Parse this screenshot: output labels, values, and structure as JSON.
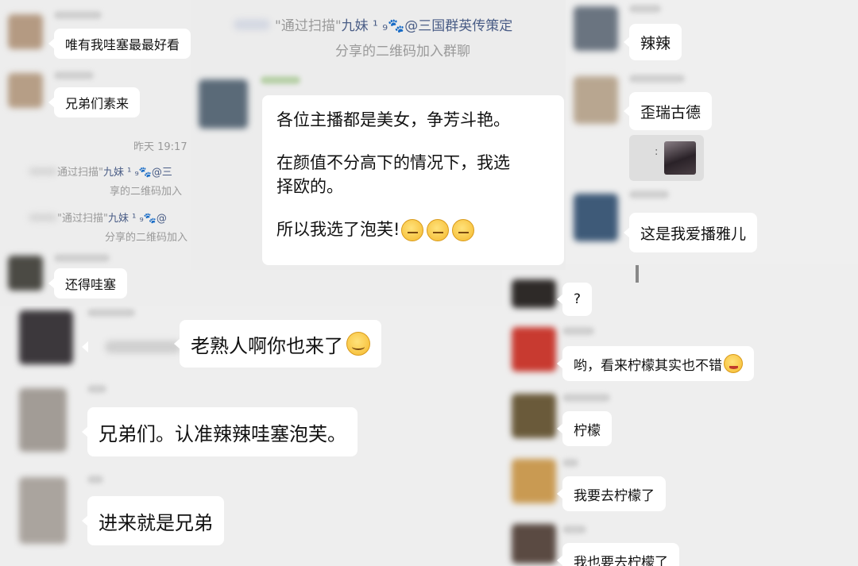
{
  "left_top": {
    "messages": [
      {
        "text": "唯有我哇塞最最好看"
      },
      {
        "text": "兄弟们素来"
      }
    ],
    "timestamp": "昨天 19:17",
    "system_notices": [
      {
        "prefix": "通过扫描\"",
        "name": "九妹 ¹ ₉🐾@三",
        "suffix": ""
      },
      {
        "line2": "享的二维码加入"
      },
      {
        "prefix": "\"通过扫描\"",
        "name": "九妹 ¹ ₉🐾@",
        "suffix": ""
      },
      {
        "line2": "分享的二维码加入"
      }
    ],
    "last_message": "还得哇塞"
  },
  "top_center": {
    "notice_prefix": "\"通过扫描\"",
    "notice_name": "九妹 ¹ ₉🐾@三国群英传策定",
    "notice_line2": "分享的二维码加入群聊",
    "big_message": {
      "line1": "各位主播都是美女，争芳斗艳。",
      "line2": "在颜值不分高下的情况下，我选",
      "line3": "择欧的。",
      "line4": "所以我选了泡芙!"
    }
  },
  "left_bottom": {
    "messages": [
      {
        "text": "老熟人啊你也来了"
      },
      {
        "text": "兄弟们。认准辣辣哇塞泡芙。"
      },
      {
        "text": "进来就是兄弟"
      }
    ]
  },
  "right_top": {
    "messages": [
      {
        "text": "辣辣"
      },
      {
        "text": "歪瑞古德"
      },
      {
        "text": "这是我爱播雅儿"
      }
    ],
    "image_caption": ":"
  },
  "right_bottom": {
    "messages": [
      {
        "text": "?"
      },
      {
        "text": "哟，看来柠檬其实也不错"
      },
      {
        "text": "柠檬"
      },
      {
        "text": "我要去柠檬了"
      },
      {
        "text": "我也要去柠檬了"
      }
    ]
  },
  "colors": {
    "background": "#ededed",
    "bubble": "#ffffff",
    "system_text": "#9a9a9a",
    "link": "#4a5d86"
  }
}
